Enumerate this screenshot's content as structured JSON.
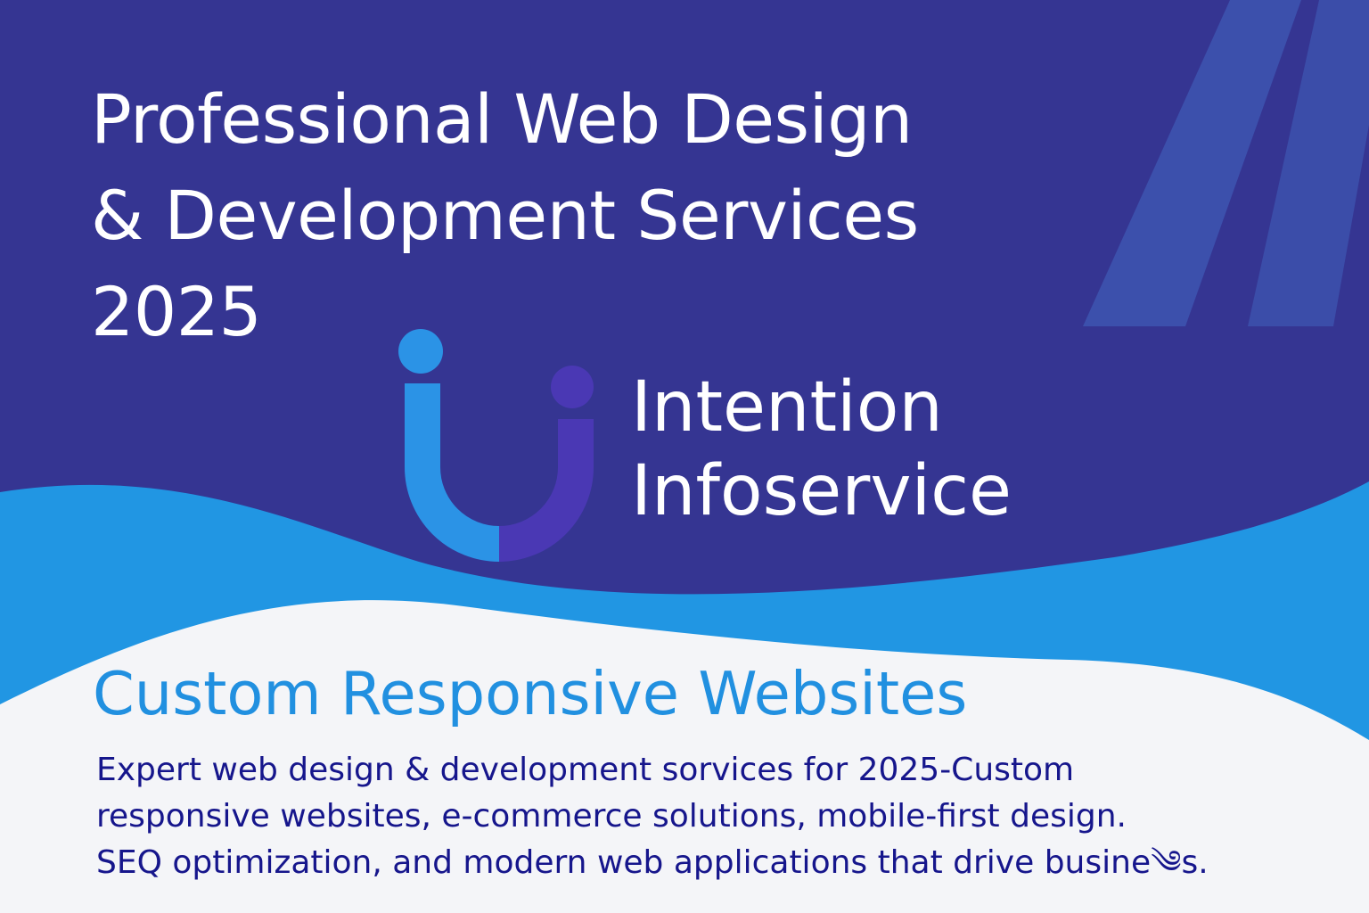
{
  "banner": {
    "headline_lines": [
      "Professional Web Design",
      "& Development Services",
      "2025"
    ],
    "brand_lines": [
      "Intention",
      "Infoservice"
    ],
    "subheading": "Custom Responsive Websites",
    "description_lines": [
      "Expert web design & development sorvices for 2025-Custom",
      "responsive websites, e-commerce solutions, mobile-first design.",
      "SEQ optimization, and modern web applications that drive busine༄s."
    ]
  },
  "colors": {
    "background_top": "#353592",
    "wave_light_blue": "#2196e3",
    "background_bottom": "#f4f5f8",
    "logo_blue": "#2b93e6",
    "logo_purple": "#4a38b4",
    "subheading": "#2190e0",
    "description": "#16168c",
    "text_white": "#ffffff"
  },
  "icons": [
    "intention-infoservice-logo-icon",
    "diagonal-stripes-decoration"
  ]
}
